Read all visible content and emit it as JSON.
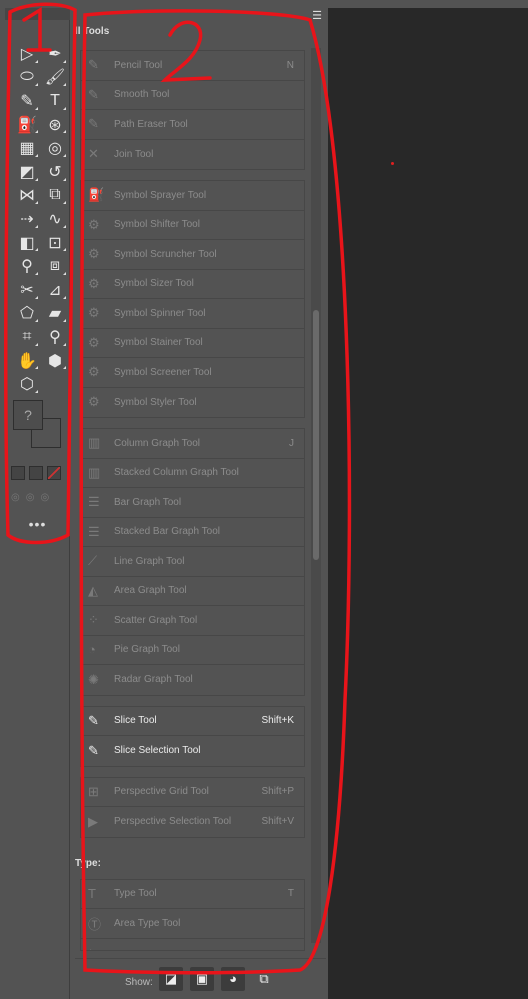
{
  "toolbar": {
    "tools": [
      {
        "name": "direct-selection",
        "glyph": "▷"
      },
      {
        "name": "pen",
        "glyph": "✒"
      },
      {
        "name": "ellipse",
        "glyph": "⬭"
      },
      {
        "name": "paintbrush",
        "glyph": "🖌"
      },
      {
        "name": "pencil",
        "glyph": "✎"
      },
      {
        "name": "type",
        "glyph": "T"
      },
      {
        "name": "symbol-sprayer",
        "glyph": "⛽"
      },
      {
        "name": "shaper",
        "glyph": "⊛"
      },
      {
        "name": "gradient",
        "glyph": "▦"
      },
      {
        "name": "lasso",
        "glyph": "◎"
      },
      {
        "name": "live-paint",
        "glyph": "◩"
      },
      {
        "name": "rotate",
        "glyph": "↺"
      },
      {
        "name": "reflect",
        "glyph": "⋈"
      },
      {
        "name": "scale",
        "glyph": "⧉"
      },
      {
        "name": "width",
        "glyph": "⇢"
      },
      {
        "name": "warp",
        "glyph": "∿"
      },
      {
        "name": "free-transform",
        "glyph": "◧"
      },
      {
        "name": "perspective",
        "glyph": "⊡"
      },
      {
        "name": "eyedropper",
        "glyph": "⚲"
      },
      {
        "name": "blend",
        "glyph": "⧈"
      },
      {
        "name": "scissors",
        "glyph": "✂"
      },
      {
        "name": "artboard",
        "glyph": "⊿"
      },
      {
        "name": "slice",
        "glyph": "⬠"
      },
      {
        "name": "eraser",
        "glyph": "▰"
      },
      {
        "name": "crop",
        "glyph": "⌗"
      },
      {
        "name": "zoom",
        "glyph": "⚲"
      },
      {
        "name": "hand",
        "glyph": "✋"
      },
      {
        "name": "3d-object",
        "glyph": "⬢"
      },
      {
        "name": "isometric",
        "glyph": "⬡"
      }
    ],
    "fill_placeholder": "?",
    "stroke_placeholder": "?",
    "more_label": "•••"
  },
  "panel": {
    "title": "ll Tools",
    "groups": [
      [
        {
          "label": "Pencil Tool",
          "shortcut": "N",
          "icon": "✎"
        },
        {
          "label": "Smooth Tool",
          "shortcut": "",
          "icon": "✎"
        },
        {
          "label": "Path Eraser Tool",
          "shortcut": "",
          "icon": "✎"
        },
        {
          "label": "Join Tool",
          "shortcut": "",
          "icon": "✕"
        }
      ],
      [
        {
          "label": "Symbol Sprayer Tool",
          "shortcut": "",
          "icon": "⛽"
        },
        {
          "label": "Symbol Shifter Tool",
          "shortcut": "",
          "icon": "⚙"
        },
        {
          "label": "Symbol Scruncher Tool",
          "shortcut": "",
          "icon": "⚙"
        },
        {
          "label": "Symbol Sizer Tool",
          "shortcut": "",
          "icon": "⚙"
        },
        {
          "label": "Symbol Spinner Tool",
          "shortcut": "",
          "icon": "⚙"
        },
        {
          "label": "Symbol Stainer Tool",
          "shortcut": "",
          "icon": "⚙"
        },
        {
          "label": "Symbol Screener Tool",
          "shortcut": "",
          "icon": "⚙"
        },
        {
          "label": "Symbol Styler Tool",
          "shortcut": "",
          "icon": "⚙"
        }
      ],
      [
        {
          "label": "Column Graph Tool",
          "shortcut": "J",
          "icon": "▥"
        },
        {
          "label": "Stacked Column Graph Tool",
          "shortcut": "",
          "icon": "▥"
        },
        {
          "label": "Bar Graph Tool",
          "shortcut": "",
          "icon": "☰"
        },
        {
          "label": "Stacked Bar Graph Tool",
          "shortcut": "",
          "icon": "☰"
        },
        {
          "label": "Line Graph Tool",
          "shortcut": "",
          "icon": "⟋"
        },
        {
          "label": "Area Graph Tool",
          "shortcut": "",
          "icon": "◭"
        },
        {
          "label": "Scatter Graph Tool",
          "shortcut": "",
          "icon": "⁘"
        },
        {
          "label": "Pie Graph Tool",
          "shortcut": "",
          "icon": "◔"
        },
        {
          "label": "Radar Graph Tool",
          "shortcut": "",
          "icon": "✺"
        }
      ],
      [
        {
          "label": "Slice Tool",
          "shortcut": "Shift+K",
          "icon": "✎",
          "active": true
        },
        {
          "label": "Slice Selection Tool",
          "shortcut": "",
          "icon": "✎",
          "active": true
        }
      ],
      [
        {
          "label": "Perspective Grid Tool",
          "shortcut": "Shift+P",
          "icon": "⊞"
        },
        {
          "label": "Perspective Selection Tool",
          "shortcut": "Shift+V",
          "icon": "▶"
        }
      ]
    ],
    "section_type": "Type:",
    "type_group": [
      {
        "label": "Type Tool",
        "shortcut": "T",
        "icon": "T"
      },
      {
        "label": "Area Type Tool",
        "shortcut": "",
        "icon": "Ⓣ"
      },
      {
        "label": "",
        "shortcut": "",
        "icon": "↘"
      }
    ],
    "footer": {
      "show_label": "Show:"
    }
  },
  "annotations": {
    "label_1": "1",
    "label_2": "2",
    "color": "#e8141a"
  }
}
